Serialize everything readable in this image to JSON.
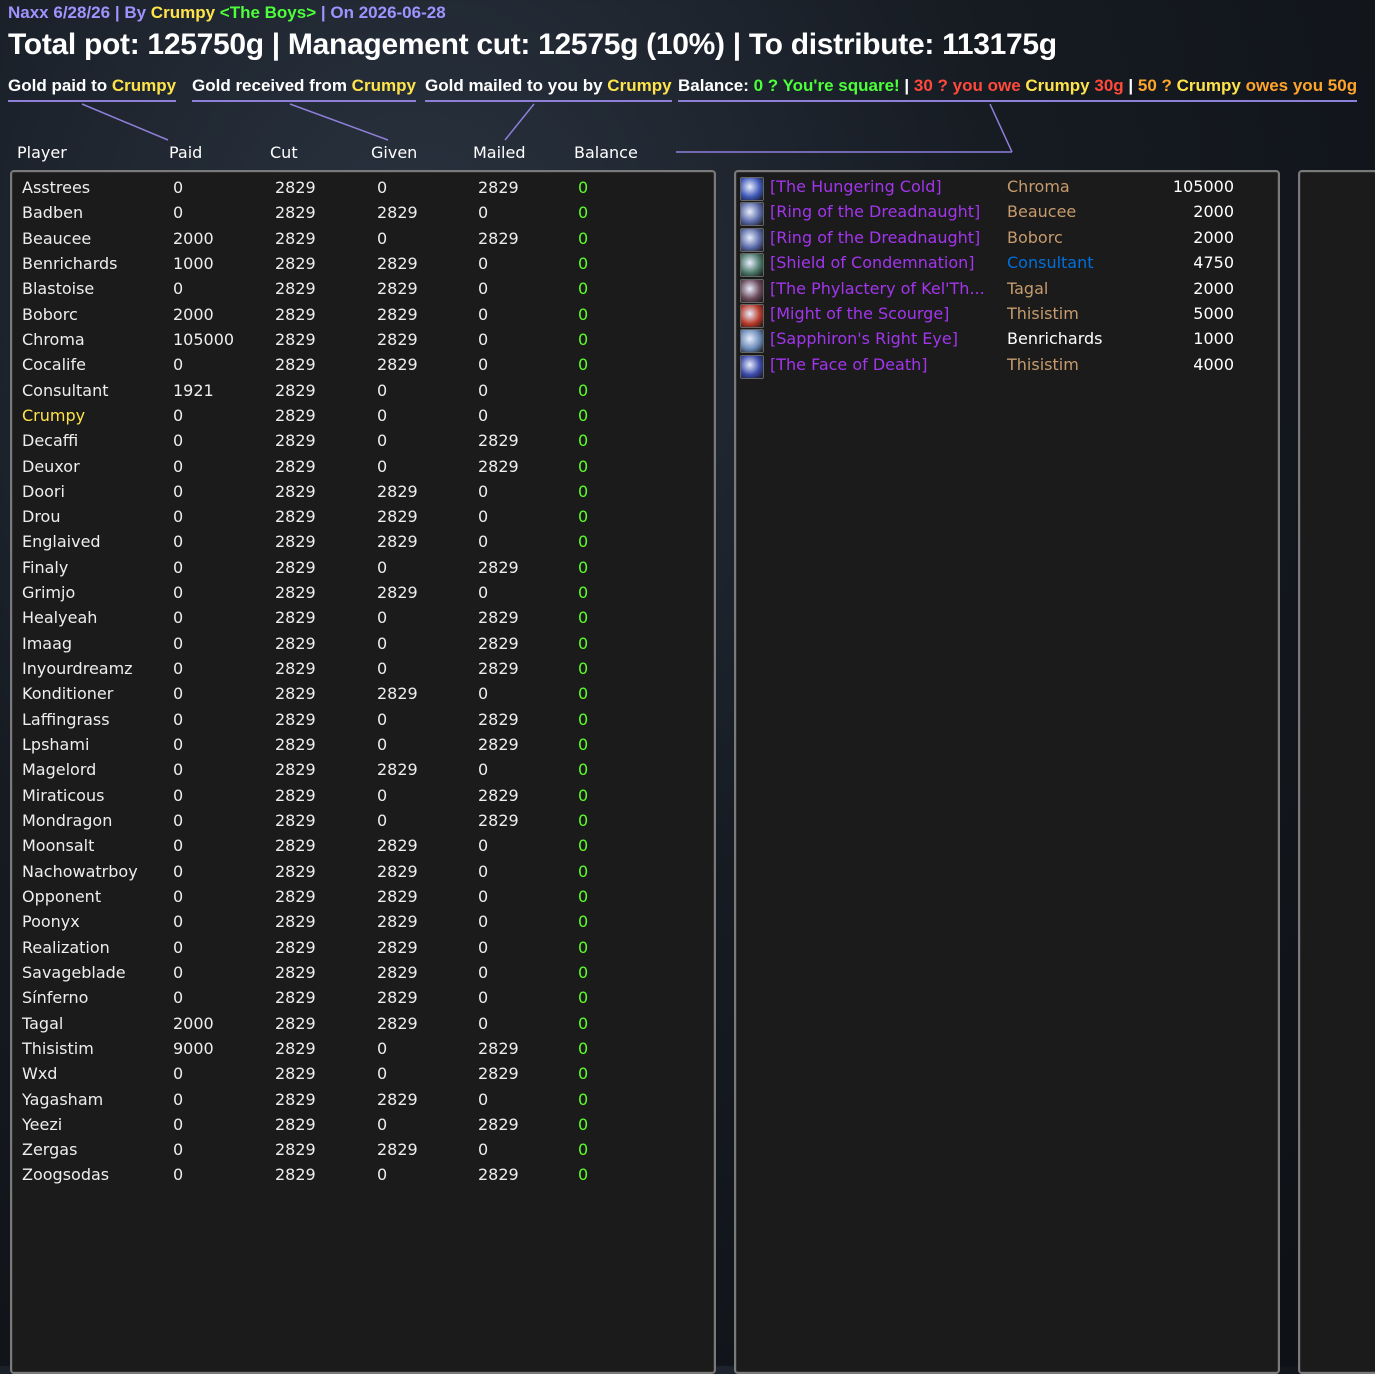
{
  "header": {
    "raid": "Naxx 6/28/26",
    "by_prefix": "By",
    "leader": "Crumpy",
    "guild": "<The Boys>",
    "date_text": "On 2026-06-28",
    "sep": "|",
    "summary": "Total pot: 125750g | Management cut: 12575g (10%) | To distribute: 113175g"
  },
  "legend": {
    "paid_prefix": "Gold paid to ",
    "received_prefix": "Gold received from ",
    "mailed_prefix": "Gold mailed to you by ",
    "name": "Crumpy",
    "balance_label": "Balance:",
    "square": "0 ? You're square!",
    "pipe": "|",
    "owe_prefix": "30 ? you owe ",
    "owe_amount": "30g",
    "owes_prefix": "50 ? ",
    "owes_suffix": " owes you 50g"
  },
  "columns": [
    "Player",
    "Paid",
    "Cut",
    "Given",
    "Mailed",
    "Balance"
  ],
  "players": [
    [
      "Asstrees",
      "0",
      "2829",
      "0",
      "2829",
      "0"
    ],
    [
      "Badben",
      "0",
      "2829",
      "2829",
      "0",
      "0"
    ],
    [
      "Beaucee",
      "2000",
      "2829",
      "0",
      "2829",
      "0"
    ],
    [
      "Benrichards",
      "1000",
      "2829",
      "2829",
      "0",
      "0"
    ],
    [
      "Blastoise",
      "0",
      "2829",
      "2829",
      "0",
      "0"
    ],
    [
      "Boborc",
      "2000",
      "2829",
      "2829",
      "0",
      "0"
    ],
    [
      "Chroma",
      "105000",
      "2829",
      "2829",
      "0",
      "0"
    ],
    [
      "Cocalife",
      "0",
      "2829",
      "2829",
      "0",
      "0"
    ],
    [
      "Consultant",
      "1921",
      "2829",
      "0",
      "0",
      "0"
    ],
    [
      "Crumpy",
      "0",
      "2829",
      "0",
      "0",
      "0"
    ],
    [
      "Decaffi",
      "0",
      "2829",
      "0",
      "2829",
      "0"
    ],
    [
      "Deuxor",
      "0",
      "2829",
      "0",
      "2829",
      "0"
    ],
    [
      "Doori",
      "0",
      "2829",
      "2829",
      "0",
      "0"
    ],
    [
      "Drou",
      "0",
      "2829",
      "2829",
      "0",
      "0"
    ],
    [
      "Englaived",
      "0",
      "2829",
      "2829",
      "0",
      "0"
    ],
    [
      "Finaly",
      "0",
      "2829",
      "0",
      "2829",
      "0"
    ],
    [
      "Grimjo",
      "0",
      "2829",
      "2829",
      "0",
      "0"
    ],
    [
      "Healyeah",
      "0",
      "2829",
      "0",
      "2829",
      "0"
    ],
    [
      "Imaag",
      "0",
      "2829",
      "0",
      "2829",
      "0"
    ],
    [
      "Inyourdreamz",
      "0",
      "2829",
      "0",
      "2829",
      "0"
    ],
    [
      "Konditioner",
      "0",
      "2829",
      "2829",
      "0",
      "0"
    ],
    [
      "Laffingrass",
      "0",
      "2829",
      "0",
      "2829",
      "0"
    ],
    [
      "Lpshami",
      "0",
      "2829",
      "0",
      "2829",
      "0"
    ],
    [
      "Magelord",
      "0",
      "2829",
      "2829",
      "0",
      "0"
    ],
    [
      "Miraticous",
      "0",
      "2829",
      "0",
      "2829",
      "0"
    ],
    [
      "Mondragon",
      "0",
      "2829",
      "0",
      "2829",
      "0"
    ],
    [
      "Moonsalt",
      "0",
      "2829",
      "2829",
      "0",
      "0"
    ],
    [
      "Nachowatrboy",
      "0",
      "2829",
      "2829",
      "0",
      "0"
    ],
    [
      "Opponent",
      "0",
      "2829",
      "2829",
      "0",
      "0"
    ],
    [
      "Poonyx",
      "0",
      "2829",
      "2829",
      "0",
      "0"
    ],
    [
      "Realization",
      "0",
      "2829",
      "2829",
      "0",
      "0"
    ],
    [
      "Savageblade",
      "0",
      "2829",
      "2829",
      "0",
      "0"
    ],
    [
      "Sínferno",
      "0",
      "2829",
      "2829",
      "0",
      "0"
    ],
    [
      "Tagal",
      "2000",
      "2829",
      "2829",
      "0",
      "0"
    ],
    [
      "Thisistim",
      "9000",
      "2829",
      "0",
      "2829",
      "0"
    ],
    [
      "Wxd",
      "0",
      "2829",
      "0",
      "2829",
      "0"
    ],
    [
      "Yagasham",
      "0",
      "2829",
      "2829",
      "0",
      "0"
    ],
    [
      "Yeezi",
      "0",
      "2829",
      "0",
      "2829",
      "0"
    ],
    [
      "Zergas",
      "0",
      "2829",
      "2829",
      "0",
      "0"
    ],
    [
      "Zoogsodas",
      "0",
      "2829",
      "0",
      "2829",
      "0"
    ]
  ],
  "items": [
    {
      "item": "[The Hungering Cold]",
      "winner": "Chroma",
      "price": "105000",
      "class": "c-warrior",
      "icon": "frost-spell-icon",
      "icon_color": "#3f57b8"
    },
    {
      "item": "[Ring of the Dreadnaught]",
      "winner": "Beaucee",
      "price": "2000",
      "class": "c-warrior",
      "icon": "ring-icon",
      "icon_color": "#5a6aa8"
    },
    {
      "item": "[Ring of the Dreadnaught]",
      "winner": "Boborc",
      "price": "2000",
      "class": "c-warrior",
      "icon": "ring-icon",
      "icon_color": "#5a6aa8"
    },
    {
      "item": "[Shield of Condemnation]",
      "winner": "Consultant",
      "price": "4750",
      "class": "c-shaman",
      "icon": "shield-icon",
      "icon_color": "#4c7a6a"
    },
    {
      "item": "[The Phylactery of Kel'Th...",
      "winner": "Tagal",
      "price": "2000",
      "class": "c-warrior",
      "icon": "phylactery-icon",
      "icon_color": "#6a4a5a"
    },
    {
      "item": "[Might of the Scourge]",
      "winner": "Thisistim",
      "price": "5000",
      "class": "c-warrior",
      "icon": "scourge-icon",
      "icon_color": "#b83a2a"
    },
    {
      "item": "[Sapphiron's Right Eye]",
      "winner": "Benrichards",
      "price": "1000",
      "class": "c-white",
      "icon": "eye-icon",
      "icon_color": "#6a8ab8"
    },
    {
      "item": "[The Face of Death]",
      "winner": "Thisistim",
      "price": "4000",
      "class": "c-warrior",
      "icon": "face-of-death-icon",
      "icon_color": "#3a4aa8"
    }
  ],
  "colors": {
    "link": "#a335ee",
    "balance_zero": "#5cff2a",
    "legend_line": "#8e7fd9"
  }
}
